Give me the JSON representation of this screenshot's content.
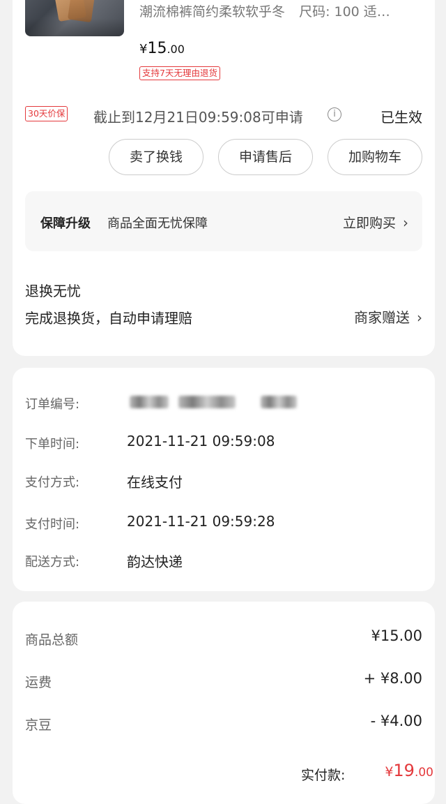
{
  "product": {
    "title": "潮流棉裤简约柔软软乎冬",
    "size": "尺码: 100 适…",
    "price_currency": "¥",
    "price_int": "15",
    "price_dec": ".00",
    "return_tag": "支持7天无理由退货"
  },
  "price_protect": {
    "tag": "30天价保",
    "deadline": "截止到12月21日09:59:08可申请",
    "info_icon": "ⓘ",
    "status": "已生效"
  },
  "actions": {
    "sell": "卖了换钱",
    "after_sale": "申请售后",
    "add_cart": "加购物车"
  },
  "upgrade": {
    "title": "保障升级",
    "desc": "商品全面无忧保障",
    "buy": "立即购买"
  },
  "return_worry": {
    "title": "退换无忧",
    "desc": "完成退换货，自动申请理赔",
    "gift": "商家赠送"
  },
  "order": {
    "number_label": "订单编号:",
    "time_label": "下单时间:",
    "time_value": "2021-11-21 09:59:08",
    "pay_method_label": "支付方式:",
    "pay_method_value": "在线支付",
    "pay_time_label": "支付时间:",
    "pay_time_value": "2021-11-21 09:59:28",
    "delivery_label": "配送方式:",
    "delivery_value": "韵达快递"
  },
  "totals": {
    "goods_label": "商品总额",
    "goods_value": "¥15.00",
    "shipping_label": "运费",
    "shipping_value": "+ ¥8.00",
    "jingdou_label": "京豆",
    "jingdou_value": "- ¥4.00",
    "paid_label": "实付款:",
    "paid_currency": "¥",
    "paid_int": "19",
    "paid_dec": ".00"
  },
  "colors": {
    "accent": "#e4393c",
    "background": "#f2f2f2"
  }
}
